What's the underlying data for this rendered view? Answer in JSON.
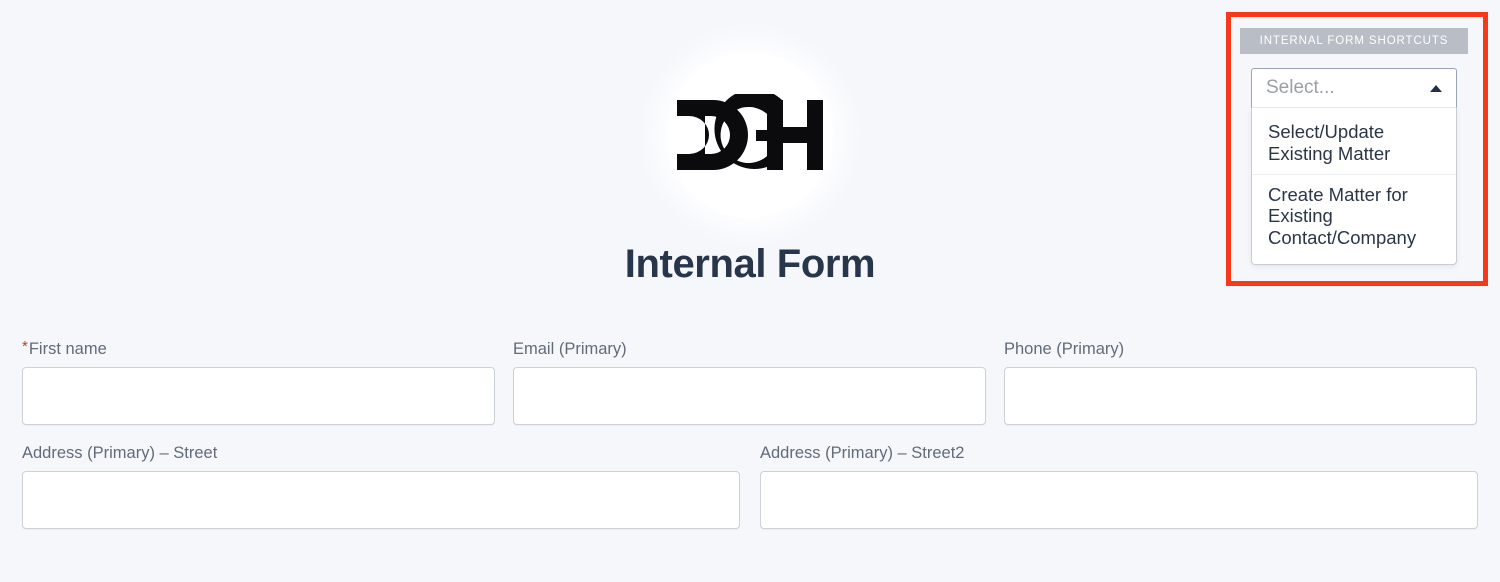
{
  "page": {
    "background_color": "#f6f7fb",
    "title": "Internal Form",
    "title_color": "#27364b"
  },
  "logo": {
    "icon": "dgh-logo-icon",
    "text": "DGH"
  },
  "shortcuts": {
    "header_label": "INTERNAL FORM SHORTCUTS",
    "header_bg": "#b9bdc5",
    "select": {
      "placeholder": "Select...",
      "value": "",
      "expanded": true,
      "caret_icon": "caret-up-icon",
      "options": [
        "Select/Update Existing Matter",
        "Create Matter for Existing Contact/Company"
      ]
    }
  },
  "highlight": {
    "name": "red-highlight-box",
    "color": "#f5391b"
  },
  "form": {
    "rows": [
      {
        "fields": [
          {
            "label": "First name",
            "required": true,
            "value": "",
            "placeholder": ""
          },
          {
            "label": "Email (Primary)",
            "required": false,
            "value": "",
            "placeholder": ""
          },
          {
            "label": "Phone (Primary)",
            "required": false,
            "value": "",
            "placeholder": ""
          }
        ]
      },
      {
        "fields": [
          {
            "label": "Address (Primary) – Street",
            "required": false,
            "value": "",
            "placeholder": ""
          },
          {
            "label": "Address (Primary) – Street2",
            "required": false,
            "value": "",
            "placeholder": ""
          }
        ]
      }
    ]
  }
}
